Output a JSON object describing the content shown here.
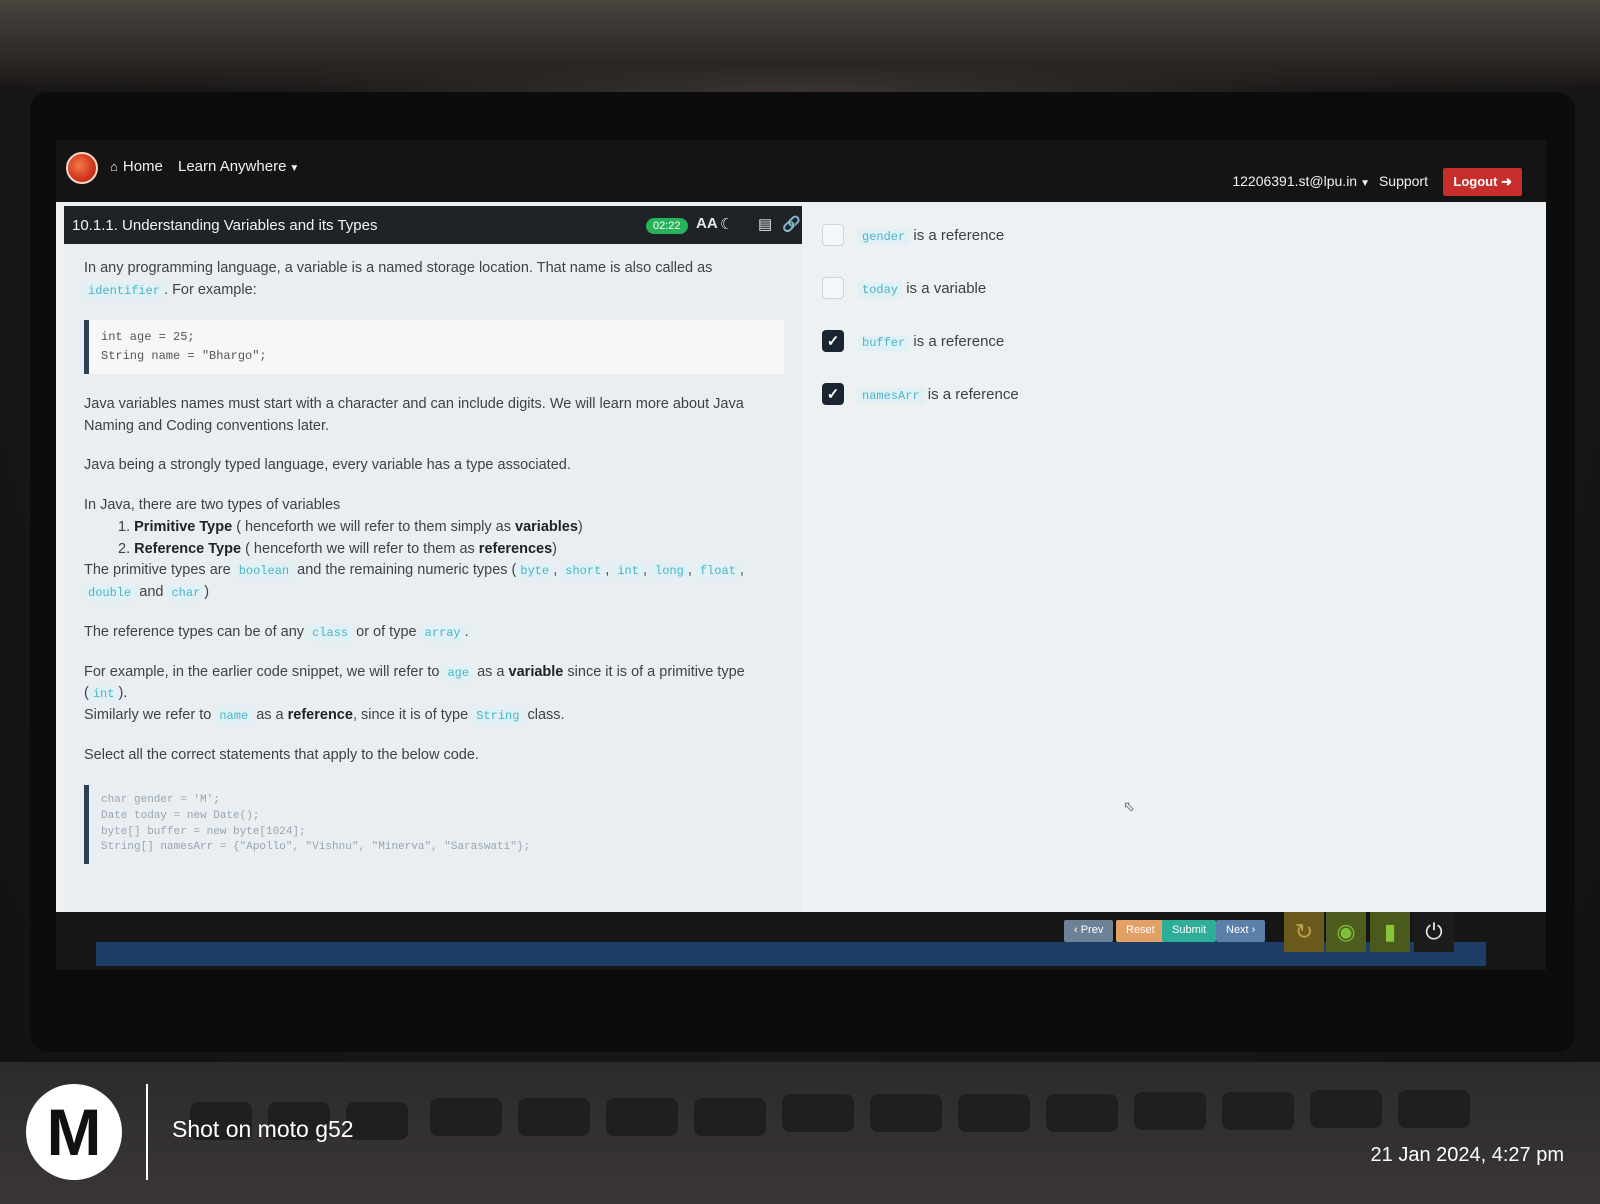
{
  "navbar": {
    "home_label": "Home",
    "learn_label": "Learn Anywhere",
    "user_email": "12206391.st@lpu.in",
    "support_label": "Support",
    "logout_label": "Logout"
  },
  "lesson": {
    "title": "10.1.1. Understanding Variables and its Types",
    "timer": "02:22",
    "intro_text": "In any programming language, a variable is a named storage location. That name is also called as",
    "identifier": "identifier",
    "intro_tail": ". For example:",
    "code_example": [
      "int age = 25;",
      "String name = \"Bhargo\";"
    ],
    "naming_text": "Java variables names must start with a character and can include digits. We will learn more about Java Naming and Coding conventions later.",
    "typed_text": "Java being a strongly typed language, every variable has a type associated.",
    "types_intro": "In Java, there are two types of variables",
    "types": [
      {
        "num": "1.",
        "name": "Primitive Type",
        "desc": "( henceforth we will refer to them simply as",
        "term": "variables",
        "close": ")"
      },
      {
        "num": "2.",
        "name": "Reference Type",
        "desc": "( henceforth we will refer to them as",
        "term": "references",
        "close": ")"
      }
    ],
    "primitive_prefix": "The primitive types are",
    "primitive_boolean": "boolean",
    "primitive_mid": "and the remaining numeric types (",
    "numeric_types": [
      "byte",
      "short",
      "int",
      "long",
      "float",
      "double"
    ],
    "and_word": "and",
    "char_type": "char",
    "ref_prefix": "The reference types can be of any",
    "ref_class": "class",
    "ref_mid": "or of type",
    "ref_array": "array",
    "example_prefix": "For example, in the earlier code snippet, we will refer to",
    "example_age": "age",
    "example_as": "as a",
    "example_variable": "variable",
    "example_since": "since it is of a primitive type",
    "example_int": "int",
    "similarly_prefix": "Similarly we refer to",
    "similarly_name": "name",
    "similarly_as": "as a",
    "similarly_reference": "reference",
    "similarly_since": ", since it is of type",
    "similarly_string": "String",
    "similarly_class": "class.",
    "select_text": "Select all the correct statements that apply to the below code.",
    "question_code": [
      "char gender = 'M';",
      "Date today = new Date();",
      "byte[] buffer = new byte[1024];",
      "String[] namesArr = {\"Apollo\", \"Vishnu\", \"Minerva\", \"Saraswati\"};"
    ]
  },
  "options": [
    {
      "code": "gender",
      "text": "is a reference",
      "checked": false
    },
    {
      "code": "today",
      "text": "is a variable",
      "checked": false
    },
    {
      "code": "buffer",
      "text": "is a reference",
      "checked": true
    },
    {
      "code": "namesArr",
      "text": "is a reference",
      "checked": true
    }
  ],
  "footer": {
    "prev_label": "‹ Prev",
    "reset_label": "Reset",
    "submit_label": "Submit",
    "next_label": "Next ›"
  },
  "watermark": {
    "shot_on": "Shot on moto g52",
    "datetime": "21 Jan 2024, 4:27 pm"
  },
  "icons": {
    "home": "home-icon",
    "font": "font-size-icon",
    "moon": "dark-mode-icon",
    "layout": "layout-icon",
    "link": "link-icon",
    "refresh": "refresh-icon",
    "wifi": "wifi-icon",
    "battery": "battery-icon",
    "power": "power-icon"
  },
  "colors": {
    "logout": "#c62d2b",
    "timer": "#27b35a",
    "submit": "#2eae99",
    "reset": "#e3a064"
  }
}
